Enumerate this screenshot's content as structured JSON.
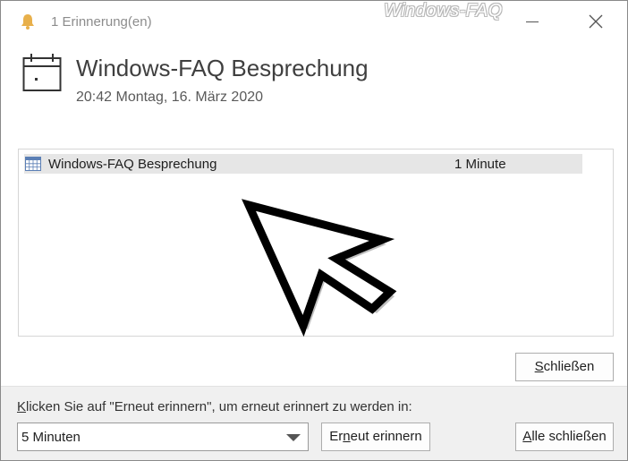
{
  "window": {
    "title": "1 Erinnerung(en)",
    "watermark": "Windows-FAQ"
  },
  "header": {
    "item_title": "Windows-FAQ Besprechung",
    "item_datetime": "20:42 Montag, 16. März 2020"
  },
  "reminders": [
    {
      "subject": "Windows-FAQ Besprechung",
      "due_in": "1 Minute"
    }
  ],
  "buttons": {
    "dismiss_mnemonic": "S",
    "dismiss_rest": "chließen",
    "snooze_first": "Er",
    "snooze_mnemonic": "n",
    "snooze_rest": "eut erinnern",
    "dismiss_all_mnemonic": "A",
    "dismiss_all_rest": "lle schließen"
  },
  "footer": {
    "snooze_label_mnemonic": "K",
    "snooze_label_rest": "licken Sie auf \"Erneut erinnern\", um erneut erinnert zu werden in:",
    "snooze_selected": "5 Minuten"
  },
  "icons": {
    "bell": "bell-icon",
    "calendar": "calendar-icon",
    "row": "calendar-grid-icon",
    "cursor": "mouse-pointer-icon"
  },
  "colors": {
    "bell": "#e8b04b",
    "row_highlight": "#e6e6e6",
    "footer_bg": "#f0f0f0",
    "row_icon_blue": "#5b7fb5"
  }
}
